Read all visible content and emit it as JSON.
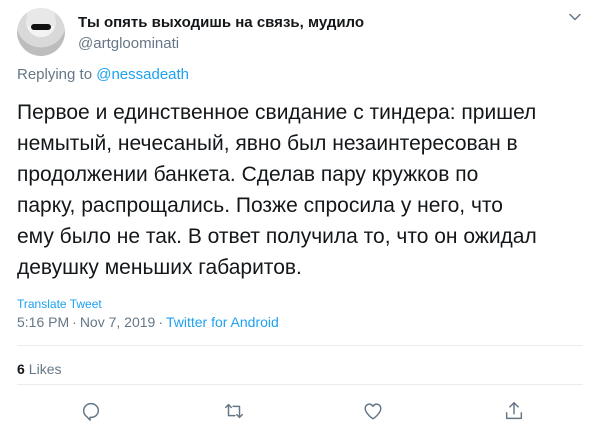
{
  "tweet": {
    "display_name": "Ты опять выходишь на связь, мудило",
    "handle": "@artgloominati",
    "replying_prefix": "Replying to",
    "replying_to": "@nessadeath",
    "text": "Первое и единственное свидание с тиндера: пришел\nнемытый, нечесаный, явно был незаинтересован в\nпродолжении банкета. Сделав пару кружков по\nпарку, распрощались. Позже спросила у него, что\nему было не так. В ответ получила то, что он ожидал\nдевушку меньших габаритов.",
    "translate_label": "Translate Tweet",
    "time": "5:16 PM",
    "separator": "·",
    "date": "Nov 7, 2019",
    "source": "Twitter for Android",
    "likes_count": "6",
    "likes_label": "Likes"
  },
  "icons": {
    "menu": "chevron-down-icon",
    "reply": "reply-icon",
    "retweet": "retweet-icon",
    "like": "heart-icon",
    "share": "share-icon"
  },
  "colors": {
    "accent": "#1da1f2",
    "muted": "#657786",
    "text": "#14171a",
    "divider": "#e6ecf0"
  }
}
